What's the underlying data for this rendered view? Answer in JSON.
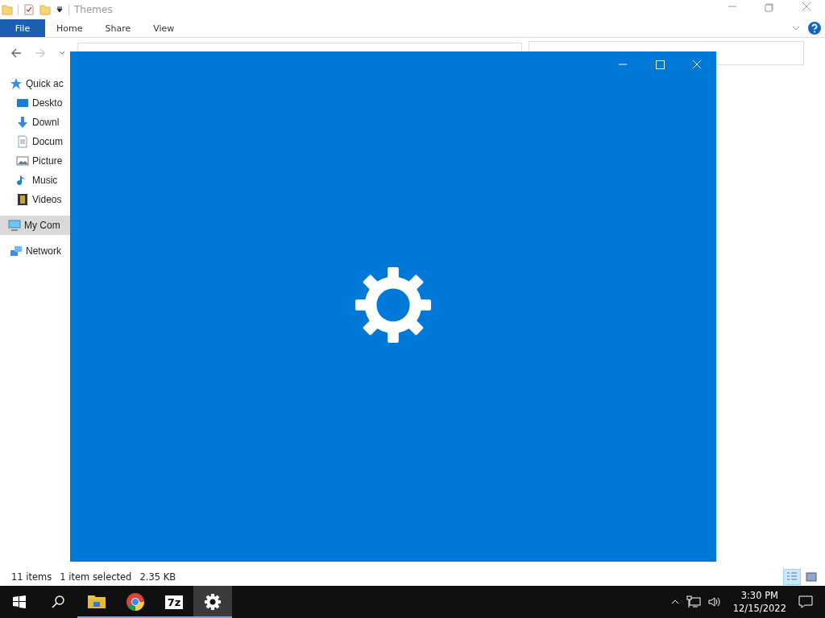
{
  "explorer": {
    "title": "Themes",
    "ribbon_tabs": [
      {
        "label": "File",
        "kind": "file",
        "selected": false
      },
      {
        "label": "Home",
        "kind": "tab",
        "selected": false
      },
      {
        "label": "Share",
        "kind": "tab",
        "selected": false
      },
      {
        "label": "View",
        "kind": "tab",
        "selected": false
      }
    ],
    "sidebar": {
      "items": [
        {
          "label": "Quick ac",
          "selected": false,
          "children": [
            {
              "label": "Deskto",
              "selected": false
            },
            {
              "label": "Downl",
              "selected": false
            },
            {
              "label": "Docum",
              "selected": false
            },
            {
              "label": "Picture",
              "selected": false
            },
            {
              "label": "Music",
              "selected": false
            },
            {
              "label": "Videos",
              "selected": false
            }
          ]
        },
        {
          "label": "My Com",
          "selected": true
        },
        {
          "label": "Network",
          "selected": false
        }
      ]
    },
    "status_bar": {
      "items": [
        "11 items",
        "1 item selected",
        "2.35 KB"
      ],
      "views": [
        {
          "kind": "details",
          "selected": true
        },
        {
          "kind": "large",
          "selected": false
        }
      ]
    }
  },
  "splash_window": {
    "kind": "settings"
  },
  "taskbar": {
    "apps": [
      {
        "kind": "explorer",
        "selected": false
      },
      {
        "kind": "chrome",
        "selected": false
      },
      {
        "kind": "sevenzip",
        "label": "7z",
        "selected": false
      },
      {
        "kind": "settings",
        "selected": true
      }
    ],
    "time": "3:30 PM",
    "date": "12/15/2022"
  }
}
